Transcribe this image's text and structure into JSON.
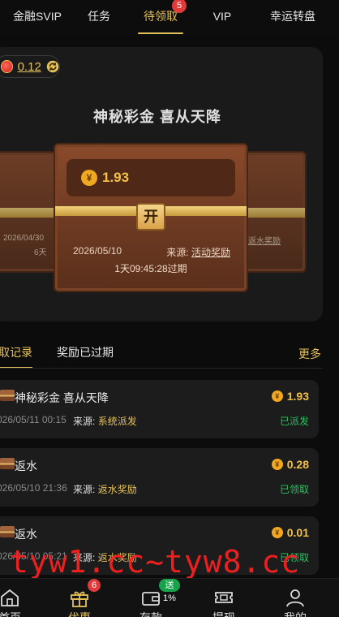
{
  "top_tabs": [
    {
      "label": "金融SVIP"
    },
    {
      "label": "任务"
    },
    {
      "label": "待领取",
      "badge": "5",
      "active": true
    },
    {
      "label": "VIP"
    },
    {
      "label": "幸运转盘"
    }
  ],
  "balance": {
    "value": "0.12"
  },
  "hero": {
    "title": "神秘彩金 喜从天降",
    "main_chest": {
      "amount": "1.93",
      "open_label": "开",
      "date": "2026/05/10",
      "source_label": "来源:",
      "source_value": "活动奖励",
      "expire_text": "1天09:45:28过期"
    },
    "left_chest": {
      "date": "2026/04/30",
      "days": "6天"
    },
    "right_chest": {
      "source_value": "返水奖励"
    }
  },
  "sub_tabs": {
    "records_label": "取记录",
    "expired_label": "奖励已过期",
    "more_label": "更多"
  },
  "records": [
    {
      "title": "神秘彩金 喜从天降",
      "amount": "1.93",
      "time": "026/05/11 00:15",
      "source_label": "来源:",
      "source_value": "系统派发",
      "status": "已派发"
    },
    {
      "title": "返水",
      "amount": "0.28",
      "time": "026/05/10 21:36",
      "source_label": "来源:",
      "source_value": "返水奖励",
      "status": "已领取"
    },
    {
      "title": "返水",
      "amount": "0.01",
      "time": "026/05/10 05:21",
      "source_label": "来源:",
      "source_value": "返水奖励",
      "status": "已领取"
    }
  ],
  "watermark": "tyw1.cc~tyw8.cc",
  "bottom_nav": [
    {
      "label": "首页",
      "icon": "home-icon"
    },
    {
      "label": "优惠",
      "icon": "gift-icon",
      "badge": "6",
      "active": true
    },
    {
      "label": "存款",
      "icon": "wallet-icon",
      "badge": "送1%"
    },
    {
      "label": "提现",
      "icon": "ticket-icon"
    },
    {
      "label": "我的",
      "icon": "user-icon"
    }
  ],
  "colors": {
    "accent": "#e6c15a",
    "background": "#0c0c0c",
    "success": "#22c55e",
    "badge": "#e03a3a"
  }
}
